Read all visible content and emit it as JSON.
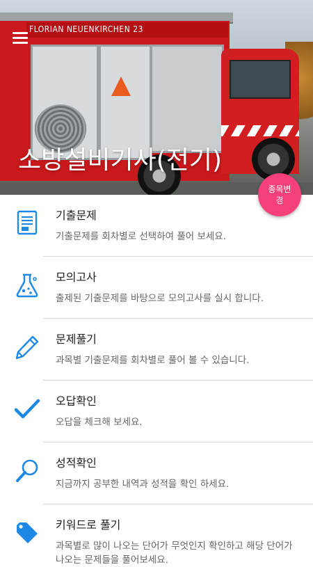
{
  "header": {
    "title": "소방설비기사(전기)",
    "truck_text": "FLORIAN NEUENKIRCHEN 23",
    "change_button_label": "종목변경"
  },
  "menu": {
    "items": [
      {
        "title": "기출문제",
        "desc": "기출문제를 회차별로 선택하여 풀어 보세요.",
        "icon": "document-list-icon"
      },
      {
        "title": "모의고사",
        "desc": "출제된 기출문제를 바탕으로 모의고사를 실시 합니다.",
        "icon": "flask-icon"
      },
      {
        "title": "문제풀기",
        "desc": "과목별 기출문제를 회차별로 풀어 볼 수 있습니다.",
        "icon": "pencil-icon"
      },
      {
        "title": "오답확인",
        "desc": "오답을 체크해 보세요.",
        "icon": "check-icon"
      },
      {
        "title": "성적확인",
        "desc": "지금까지 공부한 내역과 성적을 확인 하세요.",
        "icon": "search-icon"
      },
      {
        "title": "키워드로 풀기",
        "desc": "과목별로 많이 나오는 단어가 무엇인지 확인하고 해당 단어가 나오는 문제들을 풀어보세요.",
        "icon": "tag-icon"
      }
    ]
  },
  "colors": {
    "accent": "#1e88e5",
    "fab": "#f5407a"
  }
}
